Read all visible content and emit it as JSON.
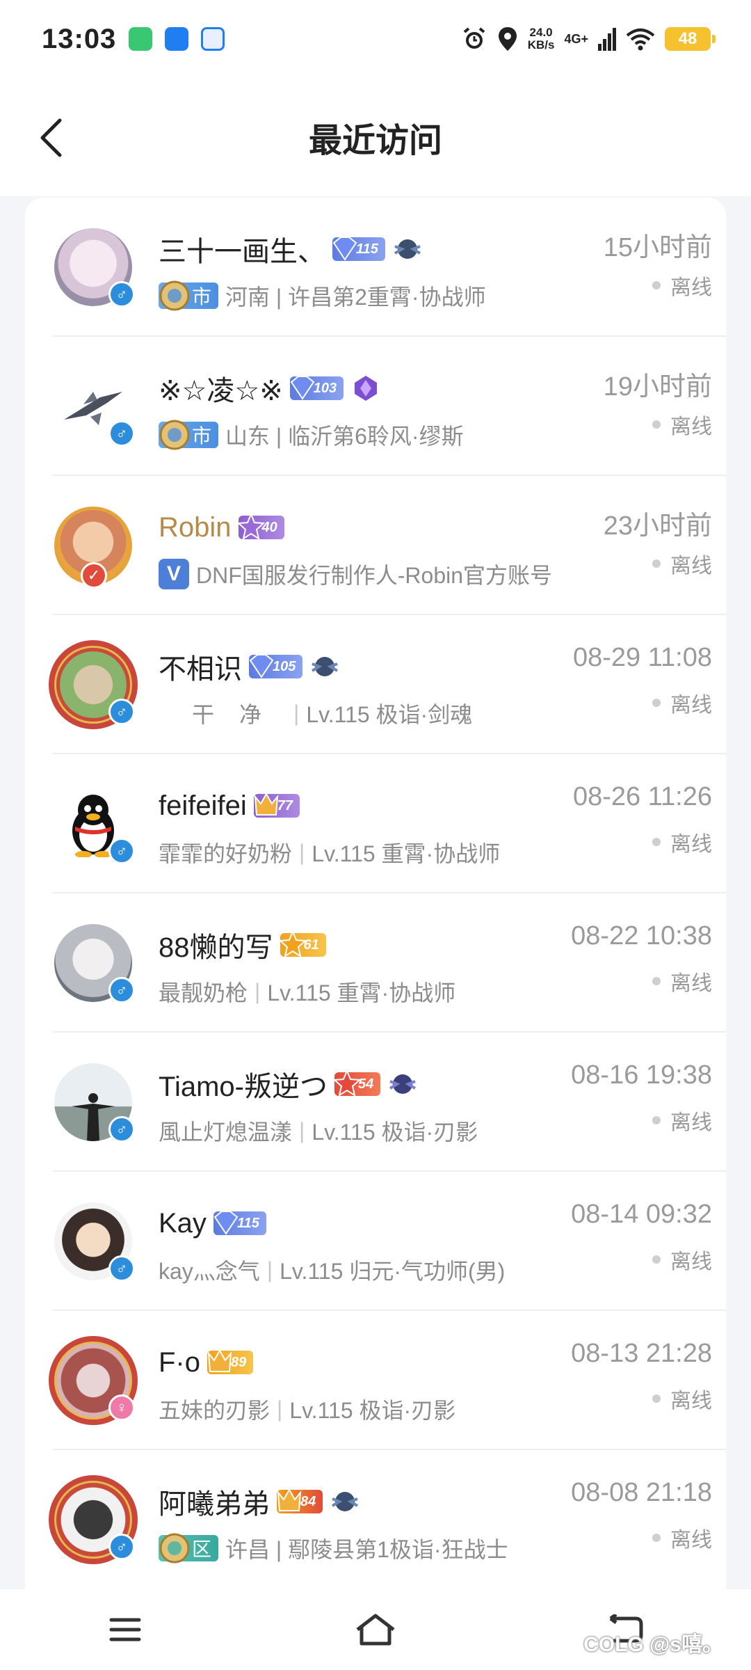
{
  "status_bar": {
    "time": "13:03",
    "speed_value": "24.0",
    "speed_unit": "KB/s",
    "network": "4G+",
    "battery": "48"
  },
  "header": {
    "title": "最近访问"
  },
  "visitors": [
    {
      "name": "三十一画生、",
      "badge": "115",
      "time": "15小时前",
      "status": "离线",
      "region_tag": "市",
      "sub": "河南 | 许昌第2重霄·协战师",
      "gender": "♂"
    },
    {
      "name": "※☆凌☆※",
      "badge": "103",
      "time": "19小时前",
      "status": "离线",
      "region_tag": "市",
      "sub": "山东 | 临沂第6聆风·缪斯",
      "gender": "♂"
    },
    {
      "name": "Robin",
      "badge": "40",
      "time": "23小时前",
      "status": "离线",
      "verified": "V",
      "sub": "DNF国服发行制作人-Robin官方账号"
    },
    {
      "name": "不相识",
      "badge": "105",
      "time": "08-29 11:08",
      "status": "离线",
      "nickname": "干净",
      "sub": "Lv.115 极诣·剑魂",
      "gender": "♂"
    },
    {
      "name": "feifeifei",
      "badge": "77",
      "time": "08-26 11:26",
      "status": "离线",
      "nickname": "霏霏的好奶粉",
      "sub": "Lv.115 重霄·协战师",
      "gender": "♂"
    },
    {
      "name": "88懒的写",
      "badge": "61",
      "time": "08-22 10:38",
      "status": "离线",
      "nickname": "最靓奶枪",
      "sub": "Lv.115 重霄·协战师",
      "gender": "♂"
    },
    {
      "name": "Tiamo-叛逆つ",
      "badge": "54",
      "time": "08-16 19:38",
      "status": "离线",
      "nickname": "風止灯熄温漾",
      "sub": "Lv.115 极诣·刃影",
      "gender": "♂"
    },
    {
      "name": "Kay",
      "badge": "115",
      "time": "08-14 09:32",
      "status": "离线",
      "nickname": "kay灬念气",
      "sub": "Lv.115 归元·气功师(男)",
      "gender": "♂"
    },
    {
      "name": "F·o",
      "badge": "89",
      "time": "08-13 21:28",
      "status": "离线",
      "nickname": "五妹的刃影",
      "sub": "Lv.115 极诣·刃影",
      "gender": "♀"
    },
    {
      "name": "阿曦弟弟",
      "badge": "84",
      "time": "08-08 21:18",
      "status": "离线",
      "region_tag": "区",
      "sub": "许昌 | 鄢陵县第1极诣·狂战士",
      "gender": "♂"
    }
  ],
  "watermark": "COLG @s嘻。",
  "colors": {
    "male": "#2c8ddc",
    "female": "#f07aa7",
    "gold_name": "#b78a4a"
  }
}
